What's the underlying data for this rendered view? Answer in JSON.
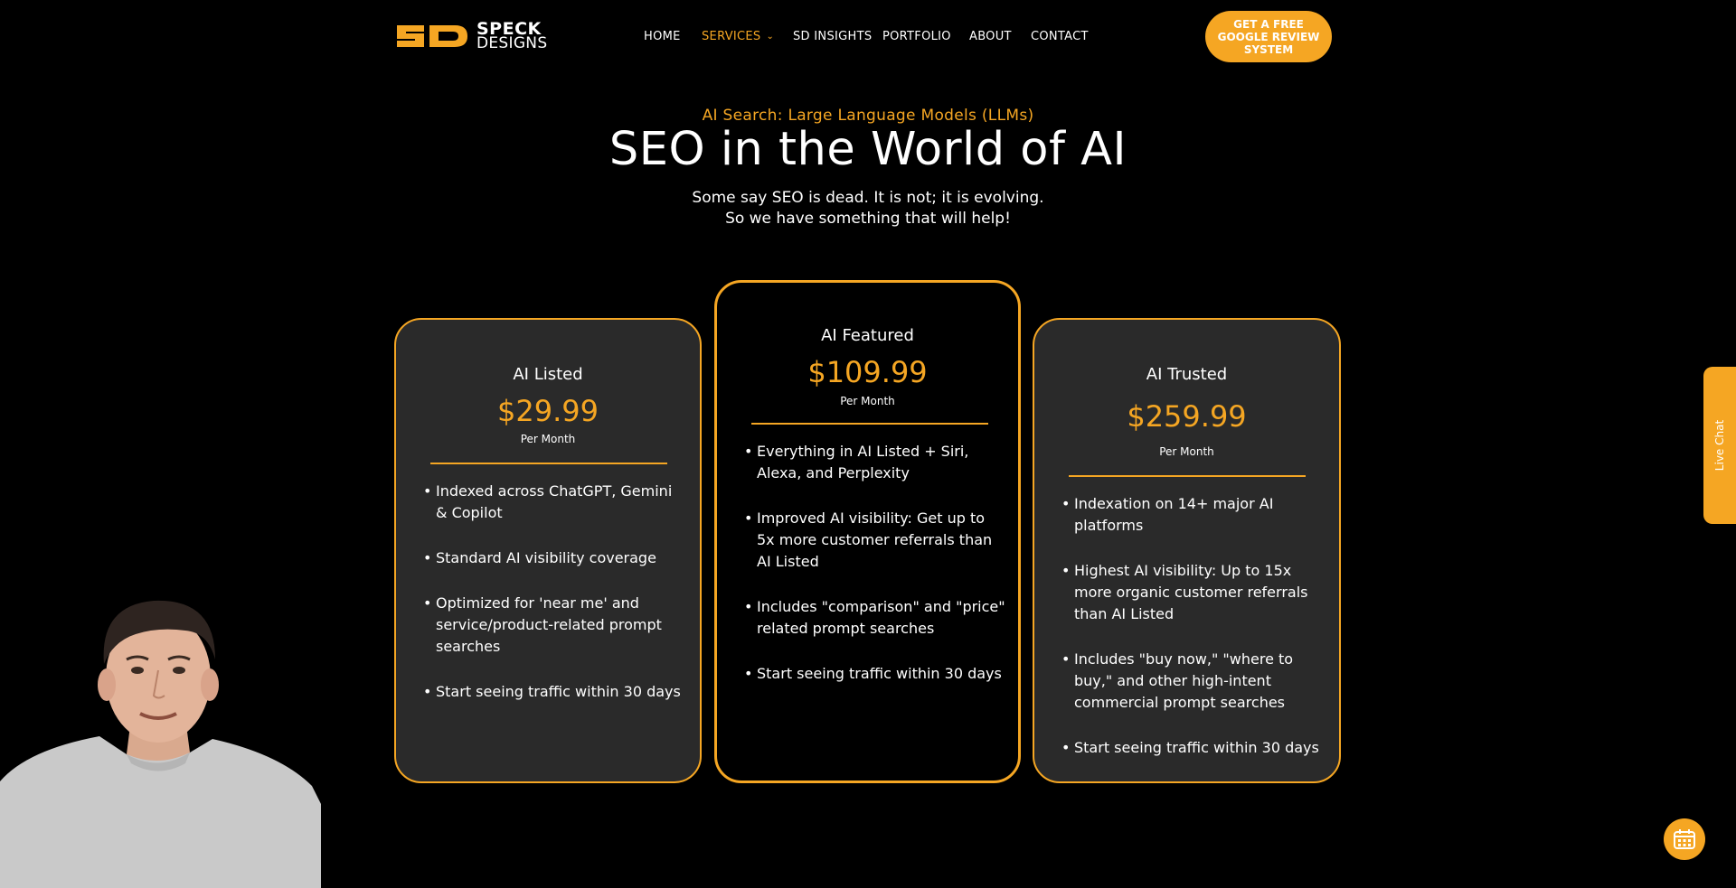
{
  "brand": {
    "logo_letters": "SD",
    "word1": "SPECK",
    "word2": "DESIGNS",
    "accent": "#f5a623"
  },
  "nav": {
    "items": [
      {
        "label": "HOME"
      },
      {
        "label": "SERVICES",
        "active": true,
        "dropdown": true
      },
      {
        "label": "SD INSIGHTS"
      },
      {
        "label": "PORTFOLIO"
      },
      {
        "label": "ABOUT"
      },
      {
        "label": "CONTACT"
      }
    ],
    "cta": "GET A FREE GOOGLE REVIEW SYSTEM"
  },
  "hero": {
    "eyebrow": "AI Search: Large Language Models (LLMs)",
    "title": "SEO in the World of AI",
    "subtitle_line1": "Some say SEO is dead. It is not; it is evolving.",
    "subtitle_line2": "So we have something that will help!"
  },
  "plans": [
    {
      "name": "AI Listed",
      "price": "$29.99",
      "period": "Per Month",
      "features": [
        "Indexed across ChatGPT, Gemini & Copilot",
        "Standard AI visibility coverage",
        "Optimized for 'near me' and service/product-related prompt searches",
        "Start seeing traffic within 30 days"
      ]
    },
    {
      "name": "AI Featured",
      "price": "$109.99",
      "period": "Per Month",
      "features": [
        "Everything in AI Listed + Siri, Alexa, and Perplexity",
        "Improved AI visibility: Get up to 5x more customer referrals than AI Listed",
        "Includes \"comparison\" and \"price\" related prompt searches",
        "Start seeing traffic within 30 days"
      ]
    },
    {
      "name": "AI Trusted",
      "price": "$259.99",
      "period": "Per Month",
      "features": [
        "Indexation on 14+ major AI platforms",
        "Highest AI visibility: Up to 15x more organic customer referrals than AI Listed",
        "Includes \"buy now,\" \"where to buy,\" and other high-intent commercial prompt searches",
        "Start seeing traffic within 30 days"
      ]
    }
  ],
  "widgets": {
    "live_chat": "Live Chat",
    "calendar_icon": "calendar-icon"
  }
}
